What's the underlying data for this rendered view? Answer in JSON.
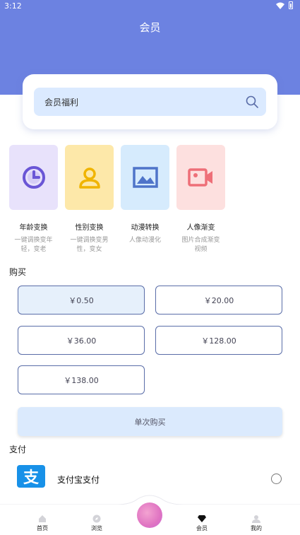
{
  "status": {
    "time": "3:12"
  },
  "header": {
    "title": "会员"
  },
  "search": {
    "text": "会员福利"
  },
  "features": [
    {
      "title": "年龄变换",
      "desc": "一键调换变年轻，变老",
      "color": "#e8e2fb",
      "icon": "clock-icon"
    },
    {
      "title": "性别变换",
      "desc": "一键调换变男性，变女",
      "color": "#fde8a9",
      "icon": "person-icon"
    },
    {
      "title": "动漫转换",
      "desc": "人像动漫化",
      "color": "#d6ebfd",
      "icon": "image-icon"
    },
    {
      "title": "人像渐变",
      "desc": "图片合成渐变视频",
      "color": "#fde0df",
      "icon": "video-camera-icon"
    }
  ],
  "purchase": {
    "title": "购买",
    "options": [
      "￥0.50",
      "￥20.00",
      "￥36.00",
      "￥128.00",
      "￥138.00"
    ],
    "selected_index": 0,
    "buy_label": "单次购买"
  },
  "payment": {
    "title": "支付",
    "method": "支付宝支付"
  },
  "nav": {
    "items": [
      "首页",
      "浏览",
      "会员",
      "我的"
    ],
    "active_index": 2
  },
  "colors": {
    "header": "#6c82e1",
    "accent": "#5a6da8"
  }
}
